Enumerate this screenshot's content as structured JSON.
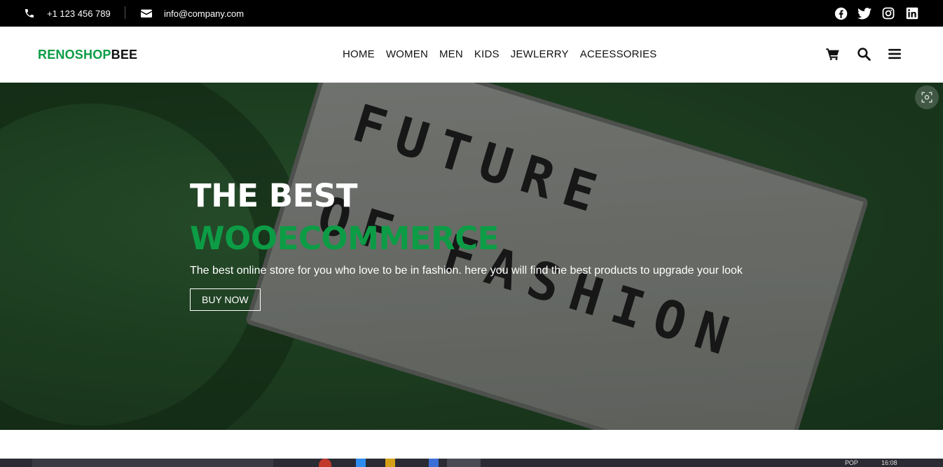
{
  "topbar": {
    "phone": "+1 123 456 789",
    "email": "info@company.com",
    "social": [
      {
        "icon": "facebook-icon"
      },
      {
        "icon": "twitter-icon"
      },
      {
        "icon": "instagram-icon"
      },
      {
        "icon": "linkedin-icon"
      }
    ]
  },
  "header": {
    "logo_part1": "RENOSHOP",
    "logo_part2": "BEE",
    "nav": [
      "HOME",
      "WOMEN",
      "MEN",
      "KIDS",
      "JEWLERRY",
      "ACEESSORIES"
    ],
    "icons": [
      "cart-icon",
      "search-icon",
      "menu-icon"
    ]
  },
  "hero": {
    "title_line1": "THE BEST",
    "title_line2": "WOOECOMMERCE",
    "subtitle": "The best online store for you who love to be in fashion. here you will find the best products to upgrade your look",
    "button": "BUY NOW",
    "image_text_line1": "FUTURE",
    "image_text_line2": "OF FASHION"
  },
  "taskbar": {
    "language": "РОР",
    "time": "16:08"
  },
  "colors": {
    "accent": "#0c9c45",
    "topbar": "#000000",
    "hero_bg": "#234a27"
  }
}
